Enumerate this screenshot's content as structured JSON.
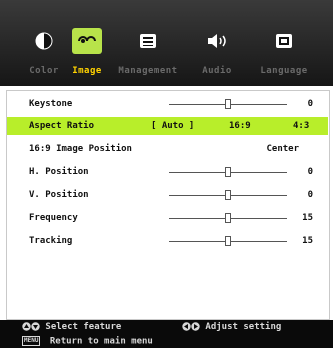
{
  "tabs": [
    {
      "label": "Color",
      "icon": "color-icon"
    },
    {
      "label": "Image",
      "icon": "image-icon",
      "active": true
    },
    {
      "label": "Management",
      "icon": "management-icon"
    },
    {
      "label": "Audio",
      "icon": "audio-icon"
    },
    {
      "label": "Language",
      "icon": "language-icon"
    }
  ],
  "menu": {
    "keystone": {
      "label": "Keystone",
      "value": "0",
      "slider": 0.5
    },
    "aspect_ratio": {
      "label": "Aspect Ratio",
      "options": [
        "[ Auto ]",
        "16:9",
        "4:3"
      ],
      "selected": "[ Auto ]"
    },
    "image_position": {
      "label": "16:9 Image Position",
      "value": "Center"
    },
    "h_position": {
      "label": "H. Position",
      "value": "0",
      "slider": 0.5
    },
    "v_position": {
      "label": "V. Position",
      "value": "0",
      "slider": 0.5
    },
    "frequency": {
      "label": "Frequency",
      "value": "15",
      "slider": 0.5
    },
    "tracking": {
      "label": "Tracking",
      "value": "15",
      "slider": 0.5
    }
  },
  "footer": {
    "select_feature": "Select feature",
    "adjust_setting": "Adjust setting",
    "menu_key": "MENU",
    "return": "Return to main menu"
  },
  "colors": {
    "accent": "#b8ee2a",
    "active_tab_label": "#ffd200",
    "footer_bg": "#0a0a0a"
  }
}
